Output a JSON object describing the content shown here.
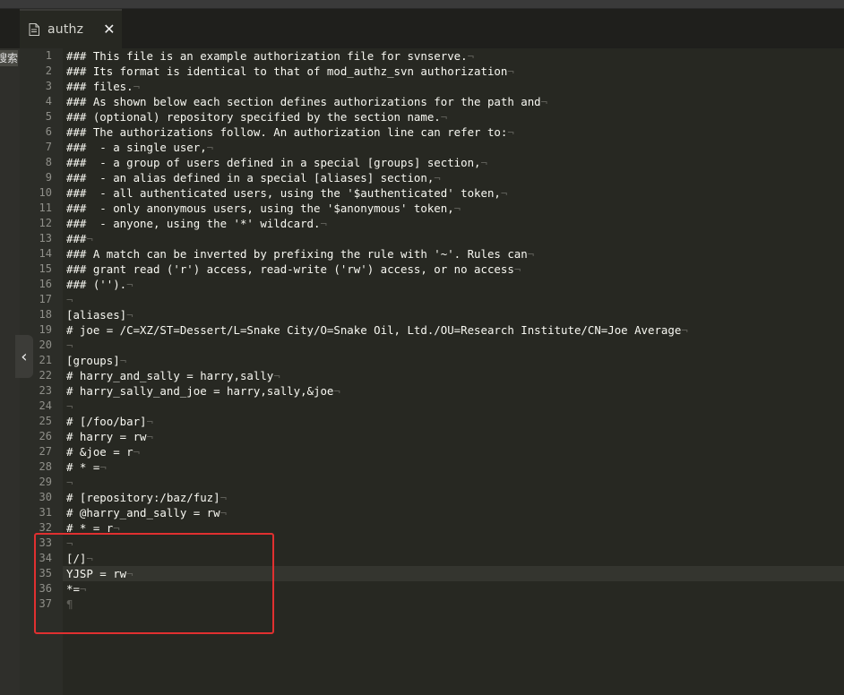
{
  "tab": {
    "title": "authz",
    "close": "✕",
    "icon": "file-icon"
  },
  "side_label": "搜索",
  "collapse": {
    "icon": "chevron-left-icon",
    "glyph": "‹"
  },
  "eol_mark": "¬",
  "last_line_mark": "¶",
  "lines": [
    "### This file is an example authorization file for svnserve.",
    "### Its format is identical to that of mod_authz_svn authorization",
    "### files.",
    "### As shown below each section defines authorizations for the path and",
    "### (optional) repository specified by the section name.",
    "### The authorizations follow. An authorization line can refer to:",
    "###  - a single user,",
    "###  - a group of users defined in a special [groups] section,",
    "###  - an alias defined in a special [aliases] section,",
    "###  - all authenticated users, using the '$authenticated' token,",
    "###  - only anonymous users, using the '$anonymous' token,",
    "###  - anyone, using the '*' wildcard.",
    "###",
    "### A match can be inverted by prefixing the rule with '~'. Rules can",
    "### grant read ('r') access, read-write ('rw') access, or no access",
    "### ('').",
    "",
    "[aliases]",
    "# joe = /C=XZ/ST=Dessert/L=Snake City/O=Snake Oil, Ltd./OU=Research Institute/CN=Joe Average",
    "",
    "[groups]",
    "# harry_and_sally = harry,sally",
    "# harry_sally_and_joe = harry,sally,&joe",
    "",
    "# [/foo/bar]",
    "# harry = rw",
    "# &joe = r",
    "# * =",
    "",
    "# [repository:/baz/fuz]",
    "# @harry_and_sally = rw",
    "# * = r",
    "",
    "[/]",
    "YJSP = rw",
    "*=",
    ""
  ],
  "colors": {
    "background": "#272822",
    "text": "#f8f8f2",
    "highlight_box": "#e03030"
  }
}
